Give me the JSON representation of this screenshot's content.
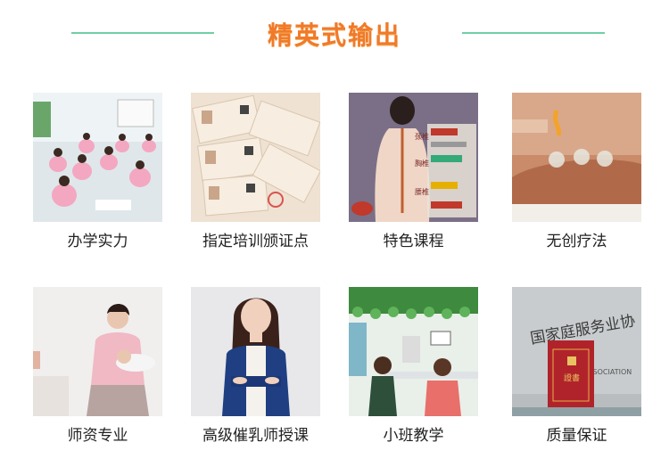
{
  "header": {
    "title": "精英式输出"
  },
  "grid": {
    "items": [
      {
        "label": "办学实力",
        "icon": "classroom-photo"
      },
      {
        "label": "指定培训颁证点",
        "icon": "certificates-photo"
      },
      {
        "label": "特色课程",
        "icon": "back-meridian-chart-photo"
      },
      {
        "label": "无创疗法",
        "icon": "cupping-therapy-photo"
      },
      {
        "label": "师资专业",
        "icon": "breastfeeding-mother-photo"
      },
      {
        "label": "高级催乳师授课",
        "icon": "instructor-portrait-photo"
      },
      {
        "label": "小班教学",
        "icon": "small-class-photo"
      },
      {
        "label": "质量保证",
        "icon": "certificate-plaque-photo"
      }
    ]
  },
  "images": {
    "chart_tags": [
      "颈椎",
      "胸椎",
      "腰椎"
    ],
    "certificate_title": "證書",
    "plaque_text": "国家庭服务业协",
    "plaque_subtext": "ASSOCIATION"
  }
}
